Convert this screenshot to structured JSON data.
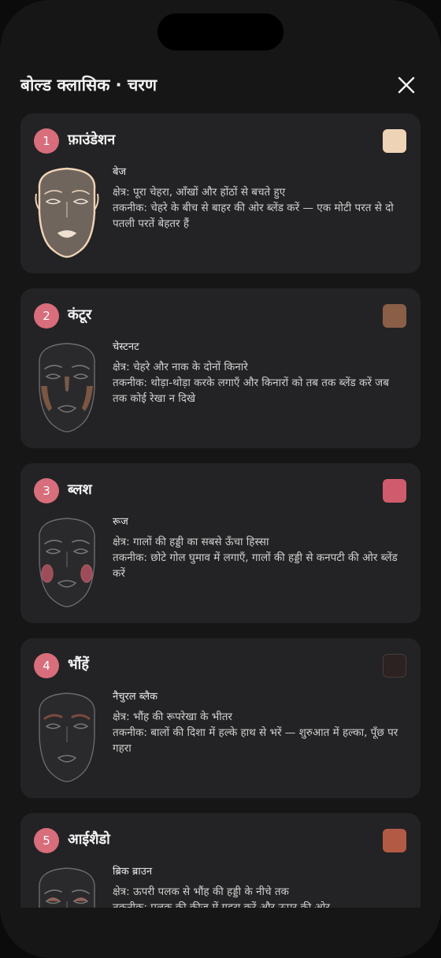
{
  "header": {
    "title": "बोल्ड क्लासिक · चरण"
  },
  "steps": [
    {
      "number": "1",
      "title": "फ़ाउंडेशन",
      "shade": "बेज",
      "color": "#efd3b6",
      "area": "क्षेत्र: पूरा चेहरा, आँखों और होंठों से बचते हुए",
      "technique": "तकनीक: चेहरे के बीच से बाहर की ओर ब्लेंड करें — एक मोटी परत से दो पतली परतें बेहतर हैं",
      "highlight": "foundation",
      "icon": "face-foundation-icon"
    },
    {
      "number": "2",
      "title": "कंटूर",
      "shade": "चेस्टनट",
      "color": "#8a5e47",
      "area": "क्षेत्र: चेहरे और नाक के दोनों किनारे",
      "technique": "तकनीक: थोड़ा-थोड़ा करके लगाएँ और किनारों को तब तक ब्लेंड करें जब तक कोई रेखा न दिखे",
      "highlight": "contour",
      "icon": "face-contour-icon"
    },
    {
      "number": "3",
      "title": "ब्लश",
      "shade": "रूज",
      "color": "#cf5b6c",
      "area": "क्षेत्र: गालों की हड्डी का सबसे ऊँचा हिस्सा",
      "technique": "तकनीक: छोटे गोल घुमाव में लगाएँ, गालों की हड्डी से कनपटी की ओर ब्लेंड करें",
      "highlight": "blush",
      "icon": "face-blush-icon"
    },
    {
      "number": "4",
      "title": "भौंहें",
      "shade": "नैचुरल ब्लैक",
      "color": "#2b2221",
      "area": "क्षेत्र: भौंह की रूपरेखा के भीतर",
      "technique": "तकनीक: बालों की दिशा में हल्के हाथ से भरें — शुरुआत में हल्का, पूँछ पर गहरा",
      "highlight": "brows",
      "icon": "face-brows-icon"
    },
    {
      "number": "5",
      "title": "आईशैडो",
      "shade": "ब्रिक ब्राउन",
      "color": "#b35a45",
      "area": "क्षेत्र: ऊपरी पलक से भौंह की हड्डी के नीचे तक",
      "technique": "तकनीक: पलक की क्रीज़ में गहरा करें और ऊपर की ओर",
      "highlight": "eyeshadow",
      "icon": "face-eyeshadow-icon"
    }
  ]
}
